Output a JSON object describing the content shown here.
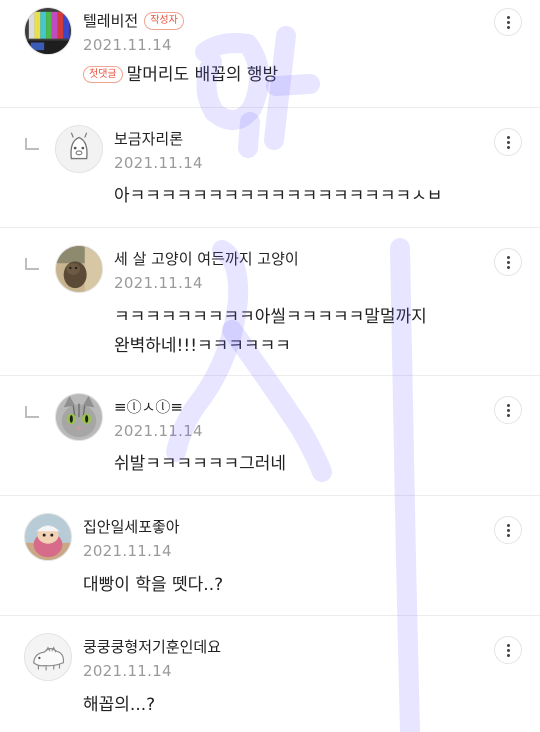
{
  "comments": [
    {
      "name": "텔레비전",
      "badge": "작성자",
      "date": "2021.11.14",
      "first_badge": "첫댓글",
      "text": "말머리도 배꼽의 행방",
      "avatar_icon": "tv-color-bars-avatar"
    },
    {
      "name": "보금자리론",
      "date": "2021.11.14",
      "text": "아ㅋㅋㅋㅋㅋㅋㅋㅋㅋㅋㅋㅋㅋㅋㅋㅋㅋㅋㅅㅂ",
      "avatar_icon": "cartoon-face-avatar"
    },
    {
      "name": "세 살 고양이 여든까지 고양이",
      "date": "2021.11.14",
      "text_line1": "ㅋㅋㅋㅋㅋㅋㅋㅋㅋ아씰ㅋㅋㅋㅋㅋ말멀까지",
      "text_line2": "완벽하네!!!ㅋㅋㅋㅋㅋㅋ",
      "avatar_icon": "cat-photo-avatar"
    },
    {
      "name": "≡ⓛㅅⓛ≡",
      "date": "2021.11.14",
      "text": "쉬발ㅋㅋㅋㅋㅋㅋ그러네",
      "avatar_icon": "cat-face-avatar"
    },
    {
      "name": "집안일세포좋아",
      "date": "2021.11.14",
      "text": "대빵이 학을 뗏다..?",
      "avatar_icon": "character-avatar"
    },
    {
      "name": "쿵쿵쿵형저기훈인데요",
      "date": "2021.11.14",
      "text": "해꼽의...?",
      "avatar_icon": "dinosaur-doodle-avatar"
    }
  ],
  "colors": {
    "badge": "#e9533d",
    "date": "#9a9a9a",
    "watermark": "#6a5cff"
  },
  "icons": {
    "more": "more-vertical-icon",
    "reply": "reply-corner-icon"
  }
}
